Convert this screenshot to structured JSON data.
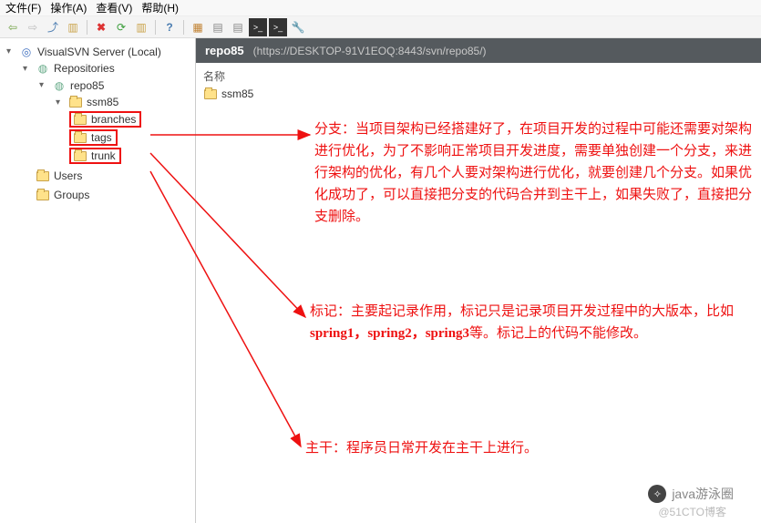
{
  "menu": {
    "file": "文件(F)",
    "operate": "操作(A)",
    "view": "查看(V)",
    "help": "帮助(H)"
  },
  "toolbar_icons": [
    "⬅",
    "➡",
    "⬆",
    "📋",
    "✖",
    "🔄",
    "🗂",
    "❓",
    "🧩",
    "▦",
    "📄",
    "📑",
    "⌨",
    "⬛",
    "🔧"
  ],
  "tree": {
    "root": "VisualSVN Server (Local)",
    "repos": "Repositories",
    "repo": "repo85",
    "proj": "ssm85",
    "branches": "branches",
    "tags": "tags",
    "trunk": "trunk",
    "users": "Users",
    "groups": "Groups"
  },
  "header": {
    "title": "repo85",
    "url": "(https://DESKTOP-91V1EOQ:8443/svn/repo85/)"
  },
  "list": {
    "col": "名称",
    "item1": "ssm85"
  },
  "annot1": "分支：当项目架构已经搭建好了，在项目开发的过程中可能还需要对架构进行优化，为了不影响正常项目开发进度，需要单独创建一个分支，来进行架构的优化，有几个人要对架构进行优化，就要创建几个分支。如果优化成功了，可以直接把分支的代码合并到主干上，如果失败了，直接把分支删除。",
  "annot2_a": "标记：主要起记录作用，标记只是记录项目开发过程中的大版本，比如",
  "annot2_b": "spring1，spring2，spring3",
  "annot2_c": "等。标记上的代码不能修改。",
  "annot3": "主干：程序员日常开发在主干上进行。",
  "wm1": "java游泳圈",
  "wm2": "@51CTO博客"
}
